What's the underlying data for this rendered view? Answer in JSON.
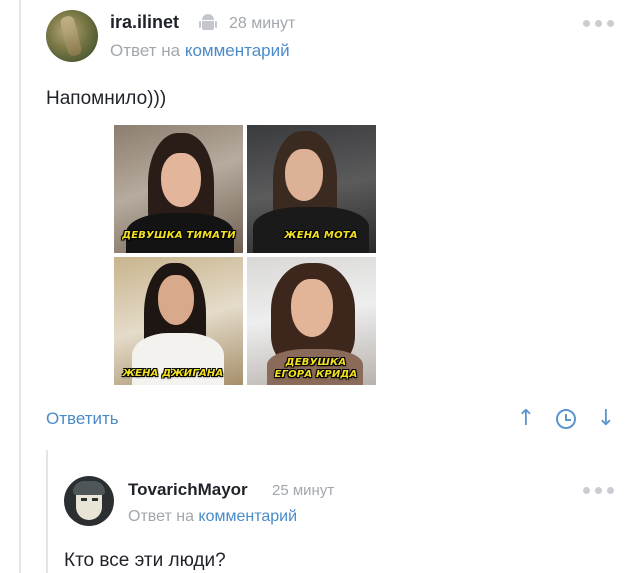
{
  "comment1": {
    "username": "ira.ilinet",
    "time": "28 минут",
    "reply_prefix": "Ответ на",
    "reply_link": "комментарий",
    "text": "Напомнило)))",
    "meme_captions": [
      "ДЕВУШКА ТИМАТИ",
      "ЖЕНА МОТА",
      "ЖЕНА ДЖИГАНА",
      "ДЕВУШКА",
      "ЕГОРА КРИДА"
    ],
    "reply_button": "Ответить",
    "icons": {
      "device": "android-icon",
      "more": "more-dots-icon",
      "upvote": "arrow-up-icon",
      "history": "clock-icon",
      "downvote": "arrow-down-icon"
    }
  },
  "comment2": {
    "username": "TovarichMayor",
    "time": "25 минут",
    "reply_prefix": "Ответ на",
    "reply_link": "комментарий",
    "text": "Кто все эти люди?",
    "icons": {
      "more": "more-dots-icon"
    }
  },
  "colors": {
    "link": "#4a8bc9",
    "meta": "#a2a7ad",
    "caption": "#f3e11f"
  }
}
